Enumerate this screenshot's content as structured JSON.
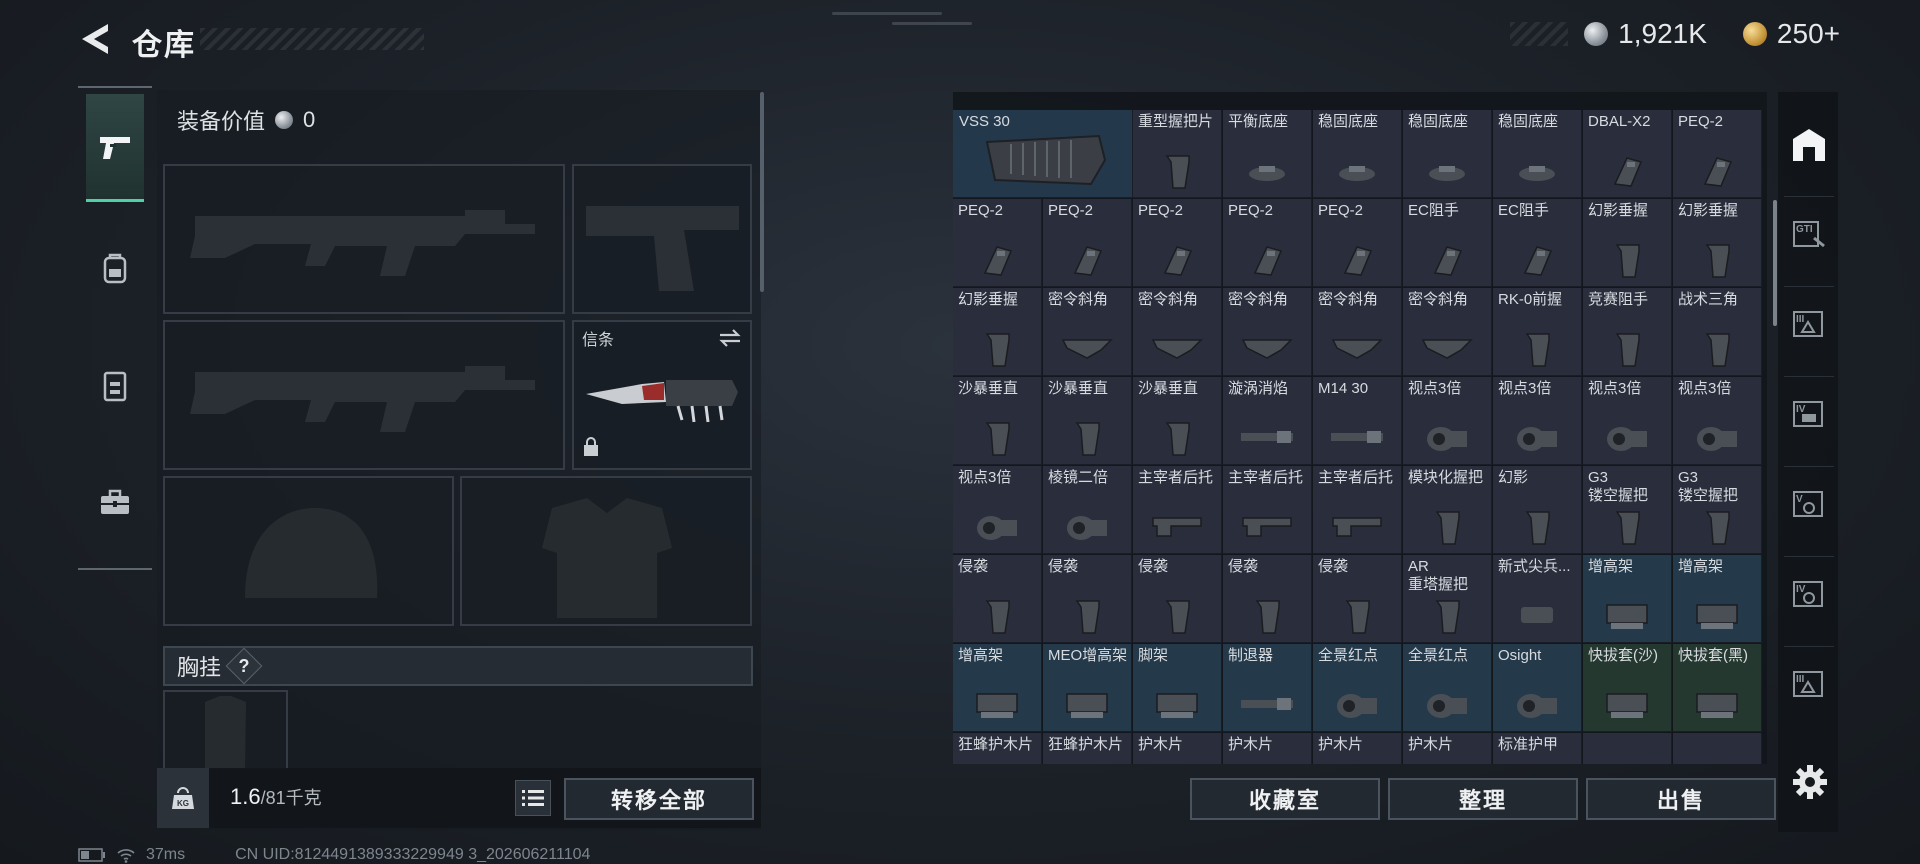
{
  "header": {
    "title": "仓库",
    "currency_silver": "1,921K",
    "currency_gold": "250+"
  },
  "loadout": {
    "equip_value_label": "装备价值",
    "equip_value": "0",
    "melee_label": "信条",
    "chest_rig_label": "胸挂",
    "help_label": "?"
  },
  "bottom": {
    "weight_current": "1.6",
    "weight_max": "/81千克",
    "transfer_all": "转移全部",
    "collection": "收藏室",
    "organize": "整理",
    "sell": "出售"
  },
  "status": {
    "ping": "37ms",
    "uid": "CN UID:8124491389333229949 3_202606211104"
  },
  "storage": {
    "vss_label": "VSS 30",
    "row0": [
      "重型握把片",
      "平衡底座",
      "稳固底座",
      "稳固底座",
      "稳固底座",
      "DBAL-X2",
      "PEQ-2"
    ],
    "row1": [
      "PEQ-2",
      "PEQ-2",
      "PEQ-2",
      "PEQ-2",
      "PEQ-2",
      "EC阻手",
      "EC阻手",
      "幻影垂握",
      "幻影垂握"
    ],
    "row2": [
      "幻影垂握",
      "密令斜角",
      "密令斜角",
      "密令斜角",
      "密令斜角",
      "密令斜角",
      "RK-0前握",
      "竞赛阻手",
      "战术三角"
    ],
    "row3": [
      "沙暴垂直",
      "沙暴垂直",
      "沙暴垂直",
      "漩涡消焰",
      "M14 30",
      "视点3倍",
      "视点3倍",
      "视点3倍",
      "视点3倍"
    ],
    "row4": [
      "视点3倍",
      "棱镜二倍",
      "主宰者后托",
      "主宰者后托",
      "主宰者后托",
      "模块化握把",
      "幻影",
      "G3\n镂空握把",
      "G3\n镂空握把"
    ],
    "row5": [
      "侵袭",
      "侵袭",
      "侵袭",
      "侵袭",
      "侵袭",
      "AR\n重塔握把",
      "新式尖兵...",
      "增高架",
      "增高架"
    ],
    "row6": [
      "增高架",
      "MEO增高架",
      "脚架",
      "制退器",
      "全景红点",
      "全景红点",
      "Osight",
      "快拔套(沙)",
      "快拔套(黑)"
    ],
    "row7": [
      "狂蜂护木片",
      "狂蜂护木片",
      "护木片",
      "护木片",
      "护木片",
      "护木片",
      "标准护甲",
      "",
      ""
    ]
  },
  "colors": {
    "accent": "#4fd1a6",
    "cell_default": "#2a2d3b",
    "cell_blue": "#24394a",
    "cell_green": "#25382f"
  }
}
